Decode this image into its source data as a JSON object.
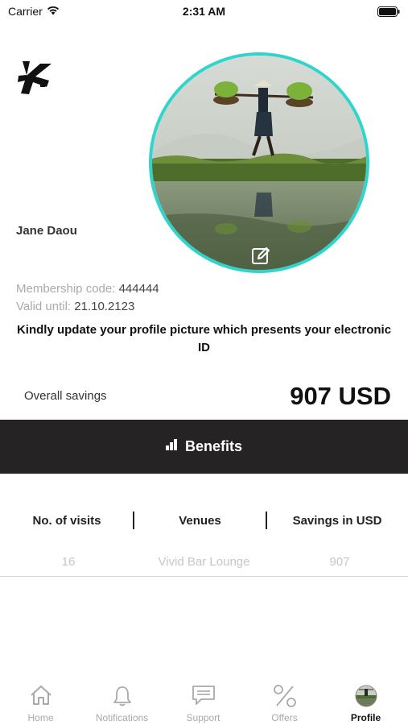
{
  "status_bar": {
    "carrier": "Carrier",
    "time": "2:31 AM"
  },
  "profile": {
    "name": "Jane Daou",
    "membership_label": "Membership code:",
    "membership_code": "444444",
    "valid_label": "Valid until:",
    "valid_until": "21.10.2123",
    "notice": "Kindly update your profile picture which presents your electronic ID"
  },
  "savings": {
    "label": "Overall savings",
    "value": "907 USD"
  },
  "benefits": {
    "label": "Benefits"
  },
  "table": {
    "headers": [
      "No. of visits",
      "Venues",
      "Savings in USD"
    ],
    "rows": [
      [
        "16",
        "Vivid Bar Lounge",
        "907"
      ]
    ]
  },
  "tabbar": {
    "items": [
      {
        "label": "Home",
        "icon": "home-icon"
      },
      {
        "label": "Notifications",
        "icon": "bell-icon"
      },
      {
        "label": "Support",
        "icon": "chat-icon"
      },
      {
        "label": "Offers",
        "icon": "percent-icon"
      },
      {
        "label": "Profile",
        "icon": "avatar-icon"
      }
    ],
    "active": "Profile"
  },
  "colors": {
    "accent": "#2fd5cc",
    "bar": "#252323"
  }
}
